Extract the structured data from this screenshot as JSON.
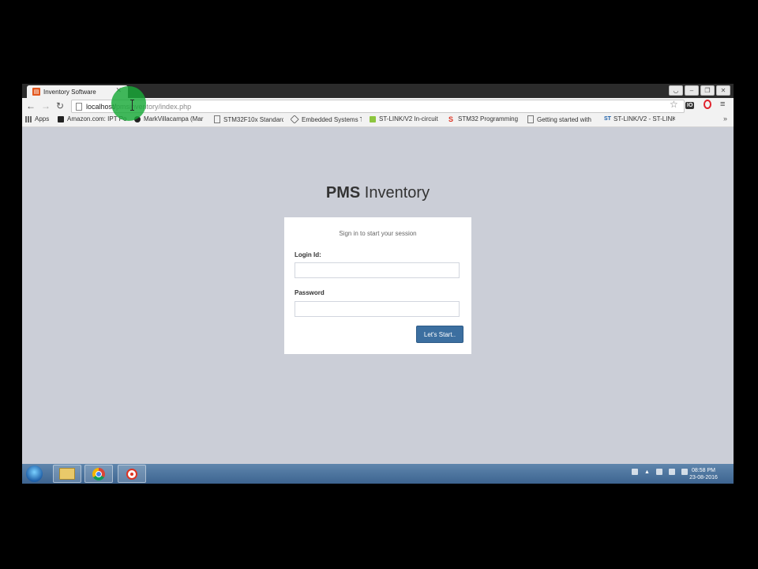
{
  "browser": {
    "tab": {
      "title": "Inventory Software"
    },
    "address": {
      "host": "localhost/",
      "path": "pmsinventory/index.php"
    },
    "bookmarks": [
      {
        "label": "Apps",
        "icon": "apps-grid-icon"
      },
      {
        "label": "Amazon.com: IPT Po",
        "icon": "amazon-icon"
      },
      {
        "label": "MarkVillacampa (Mar",
        "icon": "github-icon"
      },
      {
        "label": "STM32F10x Standard",
        "icon": "page-icon"
      },
      {
        "label": "Embedded Systems T",
        "icon": "diamond-icon"
      },
      {
        "label": "ST-LINK/V2 In-circuit",
        "icon": "st-icon"
      },
      {
        "label": "STM32 Programming",
        "icon": "s-logo-icon"
      },
      {
        "label": "Getting started with",
        "icon": "page-icon"
      },
      {
        "label": "ST-LINK/V2 - ST-LINK",
        "icon": "st-logo-icon"
      }
    ],
    "extension_label": "IO"
  },
  "login": {
    "logo_bold": "PMS",
    "logo_rest": " Inventory",
    "message": "Sign in to start your session",
    "login_id_label": "Login Id:",
    "login_id_value": "",
    "password_label": "Password",
    "password_value": "",
    "submit_label": "Let's Start.."
  },
  "taskbar": {
    "time": "08:58 PM",
    "date": "23-08-2016",
    "apps": [
      "windows-explorer",
      "google-chrome",
      "screen-recorder"
    ]
  },
  "colors": {
    "page_bg": "#cbced7",
    "button_bg": "#3c6fa0",
    "cursor_highlight": "#18aa38"
  }
}
